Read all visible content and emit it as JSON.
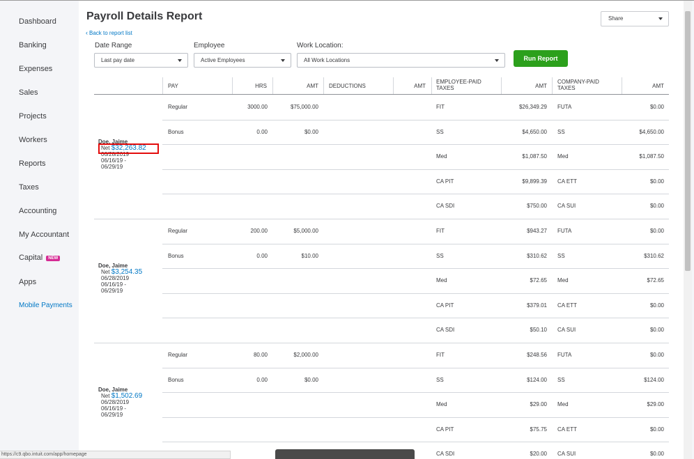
{
  "sidebar": {
    "items": [
      {
        "label": "Dashboard"
      },
      {
        "label": "Banking"
      },
      {
        "label": "Expenses"
      },
      {
        "label": "Sales"
      },
      {
        "label": "Projects"
      },
      {
        "label": "Workers"
      },
      {
        "label": "Reports"
      },
      {
        "label": "Taxes"
      },
      {
        "label": "Accounting"
      },
      {
        "label": "My Accountant"
      },
      {
        "label": "Capital",
        "badge": "NEW"
      },
      {
        "label": "Apps"
      },
      {
        "label": "Mobile Payments"
      }
    ]
  },
  "header": {
    "title": "Payroll Details Report",
    "back_link": "Back to report list",
    "share_label": "Share"
  },
  "filters": {
    "date_range": {
      "label": "Date Range",
      "value": "Last pay date"
    },
    "employee": {
      "label": "Employee",
      "value": "Active Employees"
    },
    "work_location": {
      "label": "Work Location:",
      "value": "All Work Locations"
    },
    "run_button": "Run Report"
  },
  "table": {
    "headers": {
      "pay": "PAY",
      "hrs": "HRS",
      "amt1": "AMT",
      "deductions": "DEDUCTIONS",
      "amt2": "AMT",
      "employee_taxes_1": "EMPLOYEE-PAID",
      "employee_taxes_2": "TAXES",
      "amt3": "AMT",
      "company_taxes_1": "COMPANY-PAID",
      "company_taxes_2": "TAXES",
      "amt4": "AMT"
    },
    "employees": [
      {
        "name": "Doe, Jaime",
        "net_label": "Net",
        "net": "$32,263.82",
        "date": "06/28/2019",
        "period_1": "06/16/19 -",
        "period_2": "06/29/19",
        "rows": [
          {
            "pay": "Regular",
            "hrs": "3000.00",
            "amt": "$75,000.00",
            "emp_tax": "FIT",
            "emp_amt": "$26,349.29",
            "co_tax": "FUTA",
            "co_amt": "$0.00"
          },
          {
            "pay": "Bonus",
            "hrs": "0.00",
            "amt": "$0.00",
            "emp_tax": "SS",
            "emp_amt": "$4,650.00",
            "co_tax": "SS",
            "co_amt": "$4,650.00"
          },
          {
            "pay": "",
            "hrs": "",
            "amt": "",
            "emp_tax": "Med",
            "emp_amt": "$1,087.50",
            "co_tax": "Med",
            "co_amt": "$1,087.50"
          },
          {
            "pay": "",
            "hrs": "",
            "amt": "",
            "emp_tax": "CA PIT",
            "emp_amt": "$9,899.39",
            "co_tax": "CA ETT",
            "co_amt": "$0.00"
          },
          {
            "pay": "",
            "hrs": "",
            "amt": "",
            "emp_tax": "CA SDI",
            "emp_amt": "$750.00",
            "co_tax": "CA SUI",
            "co_amt": "$0.00"
          }
        ]
      },
      {
        "name": "Doe, Jaime",
        "net_label": "Net",
        "net": "$3,254.35",
        "date": "06/28/2019",
        "period_1": "06/16/19 -",
        "period_2": "06/29/19",
        "rows": [
          {
            "pay": "Regular",
            "hrs": "200.00",
            "amt": "$5,000.00",
            "emp_tax": "FIT",
            "emp_amt": "$943.27",
            "co_tax": "FUTA",
            "co_amt": "$0.00"
          },
          {
            "pay": "Bonus",
            "hrs": "0.00",
            "amt": "$10.00",
            "emp_tax": "SS",
            "emp_amt": "$310.62",
            "co_tax": "SS",
            "co_amt": "$310.62"
          },
          {
            "pay": "",
            "hrs": "",
            "amt": "",
            "emp_tax": "Med",
            "emp_amt": "$72.65",
            "co_tax": "Med",
            "co_amt": "$72.65"
          },
          {
            "pay": "",
            "hrs": "",
            "amt": "",
            "emp_tax": "CA PIT",
            "emp_amt": "$379.01",
            "co_tax": "CA ETT",
            "co_amt": "$0.00"
          },
          {
            "pay": "",
            "hrs": "",
            "amt": "",
            "emp_tax": "CA SDI",
            "emp_amt": "$50.10",
            "co_tax": "CA SUI",
            "co_amt": "$0.00"
          }
        ]
      },
      {
        "name": "Doe, Jaime",
        "net_label": "Net",
        "net": "$1,502.69",
        "date": "06/28/2019",
        "period_1": "06/16/19 -",
        "period_2": "06/29/19",
        "rows": [
          {
            "pay": "Regular",
            "hrs": "80.00",
            "amt": "$2,000.00",
            "emp_tax": "FIT",
            "emp_amt": "$248.56",
            "co_tax": "FUTA",
            "co_amt": "$0.00"
          },
          {
            "pay": "Bonus",
            "hrs": "0.00",
            "amt": "$0.00",
            "emp_tax": "SS",
            "emp_amt": "$124.00",
            "co_tax": "SS",
            "co_amt": "$124.00"
          },
          {
            "pay": "",
            "hrs": "",
            "amt": "",
            "emp_tax": "Med",
            "emp_amt": "$29.00",
            "co_tax": "Med",
            "co_amt": "$29.00"
          },
          {
            "pay": "",
            "hrs": "",
            "amt": "",
            "emp_tax": "CA PIT",
            "emp_amt": "$75.75",
            "co_tax": "CA ETT",
            "co_amt": "$0.00"
          },
          {
            "pay": "",
            "hrs": "",
            "amt": "",
            "emp_tax": "CA SDI",
            "emp_amt": "$20.00",
            "co_tax": "CA SUI",
            "co_amt": "$0.00"
          }
        ]
      }
    ]
  },
  "status_bar": {
    "url": "https://c9.qbo.intuit.com/app/homepage"
  }
}
